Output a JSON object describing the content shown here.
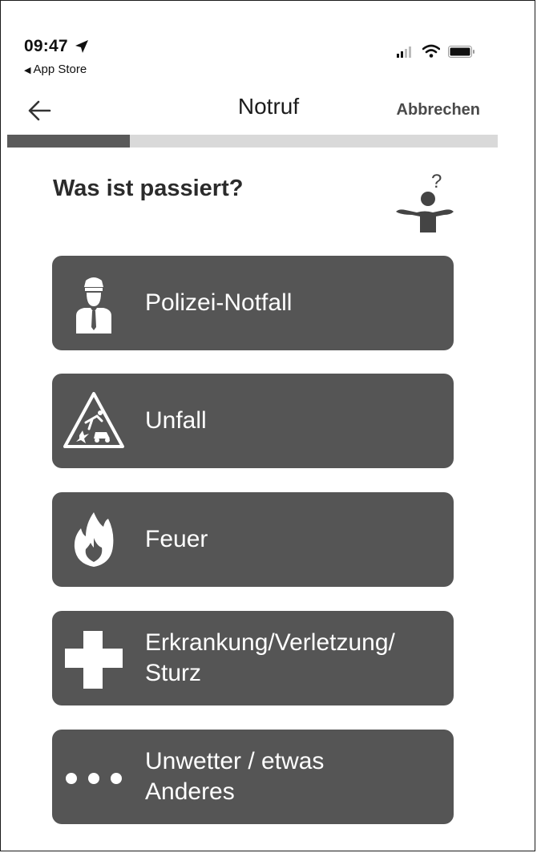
{
  "status_bar": {
    "time": "09:47",
    "back_app": "App Store"
  },
  "nav": {
    "title": "Notruf",
    "cancel_label": "Abbrechen"
  },
  "progress": {
    "fraction": 0.25
  },
  "heading": "Was ist passiert?",
  "options": [
    {
      "label": "Polizei-Notfall",
      "icon": "police-officer-icon"
    },
    {
      "label": "Unfall",
      "icon": "accident-warning-icon"
    },
    {
      "label": "Feuer",
      "icon": "fire-icon"
    },
    {
      "label": "Erkrankung/Verletzung/\nSturz",
      "icon": "medical-cross-icon"
    },
    {
      "label": "Unwetter / etwas\nAnderes",
      "icon": "more-dots-icon"
    }
  ],
  "colors": {
    "option_background": "#555555",
    "option_text": "#ffffff",
    "progress_fill": "#5a5a5a",
    "progress_track": "#d9d9d9"
  }
}
